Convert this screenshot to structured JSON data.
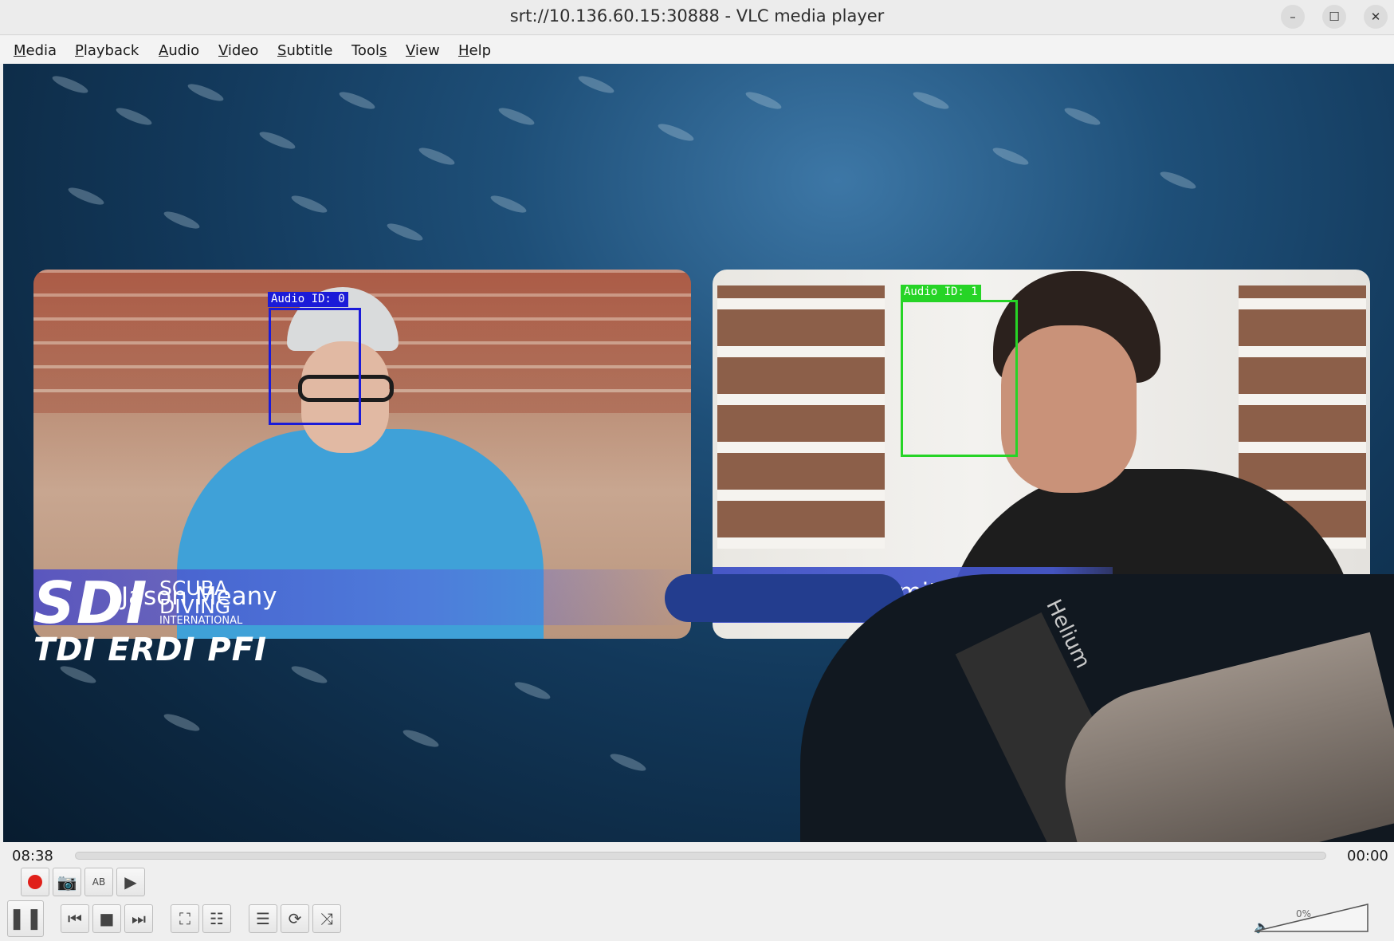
{
  "window": {
    "title": "srt://10.136.60.15:30888 - VLC media player",
    "min_icon": "minimize-icon",
    "max_icon": "maximize-icon",
    "close_icon": "close-icon",
    "min_glyph": "–",
    "max_glyph": "☐",
    "close_glyph": "✕"
  },
  "menu": [
    {
      "first": "M",
      "rest": "edia"
    },
    {
      "first": "P",
      "rest": "layback"
    },
    {
      "first": "A",
      "rest": "udio"
    },
    {
      "first": "V",
      "rest": "ideo"
    },
    {
      "first": "S",
      "rest": "ubtitle"
    },
    {
      "first": "Tool",
      "u": "s",
      "rest": ""
    },
    {
      "first": "V",
      "rest": "iew"
    },
    {
      "first": "H",
      "rest": "elp"
    }
  ],
  "video": {
    "left_name": "Jason Meany",
    "right_name": "Lewis Smithingham",
    "left_tag": "Audio ID: 0",
    "right_tag": "Audio ID: 1",
    "box_colors": {
      "left": "#1b1bd8",
      "right": "#26d426"
    },
    "logo": {
      "main": "SDI",
      "line1": "SCUBA",
      "line2": "DIVING",
      "line3": "INTERNATIONAL",
      "row2": "TDI ERDI PFI"
    },
    "strap_text": "Helium"
  },
  "playback": {
    "elapsed": "08:38",
    "total": "00:00",
    "progress": 0.0
  },
  "controls": {
    "record_icon": "record-icon",
    "snapshot_icon": "camera-icon",
    "loop_ab_icon": "loop-ab-icon",
    "frame_icon": "frame-by-frame-icon",
    "pause_icon": "pause-icon",
    "prev_icon": "previous-icon",
    "stop_icon": "stop-icon",
    "next_icon": "next-icon",
    "fullscreen_icon": "fullscreen-icon",
    "extended_icon": "extended-settings-icon",
    "playlist_icon": "playlist-icon",
    "loop_icon": "loop-icon",
    "shuffle_icon": "shuffle-icon",
    "volume_icon": "speaker-icon",
    "snapshot_glyph": "📷",
    "loop_ab_glyph": "AB",
    "frame_glyph": "▶",
    "pause_glyph": "❚❚",
    "prev_glyph": "⏮",
    "stop_glyph": "■",
    "next_glyph": "⏭",
    "fullscreen_glyph": "⛶",
    "extended_glyph": "☷",
    "playlist_glyph": "☰",
    "loop_glyph": "⟳",
    "shuffle_glyph": "⤨",
    "volume_glyph": "🔈"
  },
  "volume": {
    "label": "0%",
    "level": 0.0
  }
}
